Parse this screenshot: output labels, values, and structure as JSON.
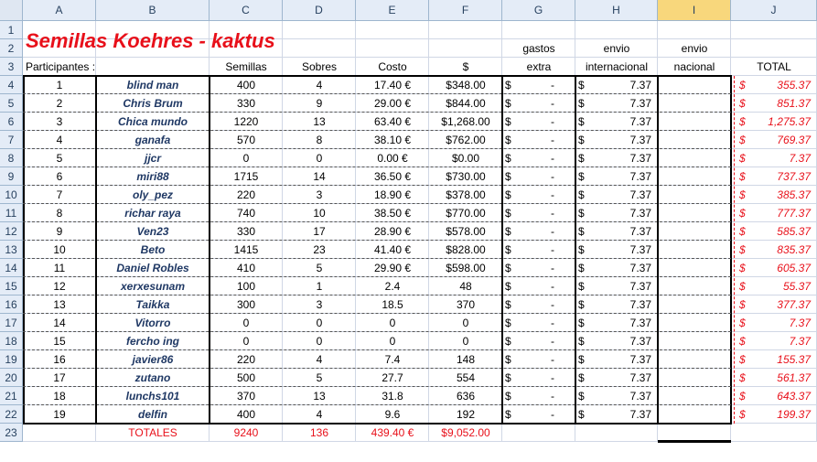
{
  "title": "Semillas Koehres - kaktus",
  "columns": [
    "A",
    "B",
    "C",
    "D",
    "E",
    "F",
    "G",
    "H",
    "I",
    "J"
  ],
  "selected_column": "I",
  "row_numbers": [
    "1",
    "2",
    "3",
    "4",
    "5",
    "6",
    "7",
    "8",
    "9",
    "10",
    "11",
    "12",
    "13",
    "14",
    "15",
    "16",
    "17",
    "18",
    "19",
    "20",
    "21",
    "22",
    "23"
  ],
  "header_row2": {
    "G": "gastos",
    "H": "envio",
    "I": "envio"
  },
  "header_row3": {
    "A": "Participantes :",
    "C": "Semillas",
    "D": "Sobres",
    "E": "Costo",
    "F": "$",
    "G": "extra",
    "H": "internacional",
    "I": "nacional",
    "J": "TOTAL"
  },
  "currency_symbol": "$",
  "dash": "-",
  "rows": [
    {
      "n": "1",
      "name": "blind man",
      "semillas": "400",
      "sobres": "4",
      "costo": "17.40 €",
      "usd": "$348.00",
      "envio": "7.37",
      "total": "355.37"
    },
    {
      "n": "2",
      "name": "Chris Brum",
      "semillas": "330",
      "sobres": "9",
      "costo": "29.00 €",
      "usd": "$844.00",
      "envio": "7.37",
      "total": "851.37"
    },
    {
      "n": "3",
      "name": "Chica mundo",
      "semillas": "1220",
      "sobres": "13",
      "costo": "63.40 €",
      "usd": "$1,268.00",
      "envio": "7.37",
      "total": "1,275.37"
    },
    {
      "n": "4",
      "name": "ganafa",
      "semillas": "570",
      "sobres": "8",
      "costo": "38.10 €",
      "usd": "$762.00",
      "envio": "7.37",
      "total": "769.37"
    },
    {
      "n": "5",
      "name": "jjcr",
      "semillas": "0",
      "sobres": "0",
      "costo": "0.00 €",
      "usd": "$0.00",
      "envio": "7.37",
      "total": "7.37"
    },
    {
      "n": "6",
      "name": "miri88",
      "semillas": "1715",
      "sobres": "14",
      "costo": "36.50 €",
      "usd": "$730.00",
      "envio": "7.37",
      "total": "737.37"
    },
    {
      "n": "7",
      "name": "oly_pez",
      "semillas": "220",
      "sobres": "3",
      "costo": "18.90 €",
      "usd": "$378.00",
      "envio": "7.37",
      "total": "385.37"
    },
    {
      "n": "8",
      "name": "richar raya",
      "semillas": "740",
      "sobres": "10",
      "costo": "38.50 €",
      "usd": "$770.00",
      "envio": "7.37",
      "total": "777.37"
    },
    {
      "n": "9",
      "name": "Ven23",
      "semillas": "330",
      "sobres": "17",
      "costo": "28.90 €",
      "usd": "$578.00",
      "envio": "7.37",
      "total": "585.37"
    },
    {
      "n": "10",
      "name": "Beto",
      "semillas": "1415",
      "sobres": "23",
      "costo": "41.40 €",
      "usd": "$828.00",
      "envio": "7.37",
      "total": "835.37"
    },
    {
      "n": "11",
      "name": "Daniel Robles",
      "semillas": "410",
      "sobres": "5",
      "costo": "29.90 €",
      "usd": "$598.00",
      "envio": "7.37",
      "total": "605.37"
    },
    {
      "n": "12",
      "name": "xerxesunam",
      "semillas": "100",
      "sobres": "1",
      "costo": "2.4",
      "usd": "48",
      "envio": "7.37",
      "total": "55.37"
    },
    {
      "n": "13",
      "name": "Taikka",
      "semillas": "300",
      "sobres": "3",
      "costo": "18.5",
      "usd": "370",
      "envio": "7.37",
      "total": "377.37"
    },
    {
      "n": "14",
      "name": "Vitorro",
      "semillas": "0",
      "sobres": "0",
      "costo": "0",
      "usd": "0",
      "envio": "7.37",
      "total": "7.37"
    },
    {
      "n": "15",
      "name": "fercho ing",
      "semillas": "0",
      "sobres": "0",
      "costo": "0",
      "usd": "0",
      "envio": "7.37",
      "total": "7.37"
    },
    {
      "n": "16",
      "name": "javier86",
      "semillas": "220",
      "sobres": "4",
      "costo": "7.4",
      "usd": "148",
      "envio": "7.37",
      "total": "155.37"
    },
    {
      "n": "17",
      "name": "zutano",
      "semillas": "500",
      "sobres": "5",
      "costo": "27.7",
      "usd": "554",
      "envio": "7.37",
      "total": "561.37"
    },
    {
      "n": "18",
      "name": "lunchs101",
      "semillas": "370",
      "sobres": "13",
      "costo": "31.8",
      "usd": "636",
      "envio": "7.37",
      "total": "643.37"
    },
    {
      "n": "19",
      "name": "delfin",
      "semillas": "400",
      "sobres": "4",
      "costo": "9.6",
      "usd": "192",
      "envio": "7.37",
      "total": "199.37"
    }
  ],
  "totals": {
    "label": "TOTALES",
    "semillas": "9240",
    "sobres": "136",
    "costo": "439.40 €",
    "usd": "$9,052.00"
  },
  "colors": {
    "accent_red": "#e8101a",
    "name_blue": "#1f3864",
    "header_bg": "#e4ecf7",
    "selected_header": "#f8d77c",
    "gridline": "#d0d7e5"
  }
}
